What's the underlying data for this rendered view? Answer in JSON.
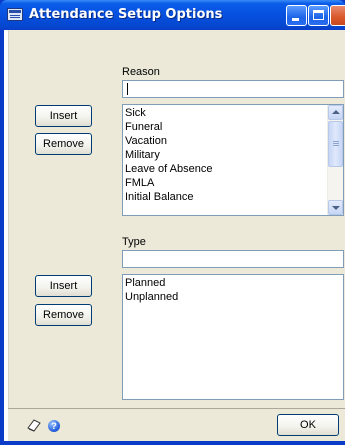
{
  "window": {
    "title": "Attendance Setup Options"
  },
  "reason": {
    "label": "Reason",
    "input_value": "",
    "insert_label": "Insert",
    "remove_label": "Remove",
    "items": [
      "Sick",
      "Funeral",
      "Vacation",
      "Military",
      "Leave of Absence",
      "FMLA",
      "Initial Balance"
    ]
  },
  "type": {
    "label": "Type",
    "input_value": "",
    "insert_label": "Insert",
    "remove_label": "Remove",
    "items": [
      "Planned",
      "Unplanned"
    ]
  },
  "footer": {
    "ok_label": "OK",
    "help_icon": "?"
  },
  "icons": [
    "window-icon",
    "minimize-icon",
    "maximize-icon",
    "close-icon",
    "notes-icon",
    "help-icon",
    "scroll-up-icon",
    "scroll-down-icon"
  ]
}
